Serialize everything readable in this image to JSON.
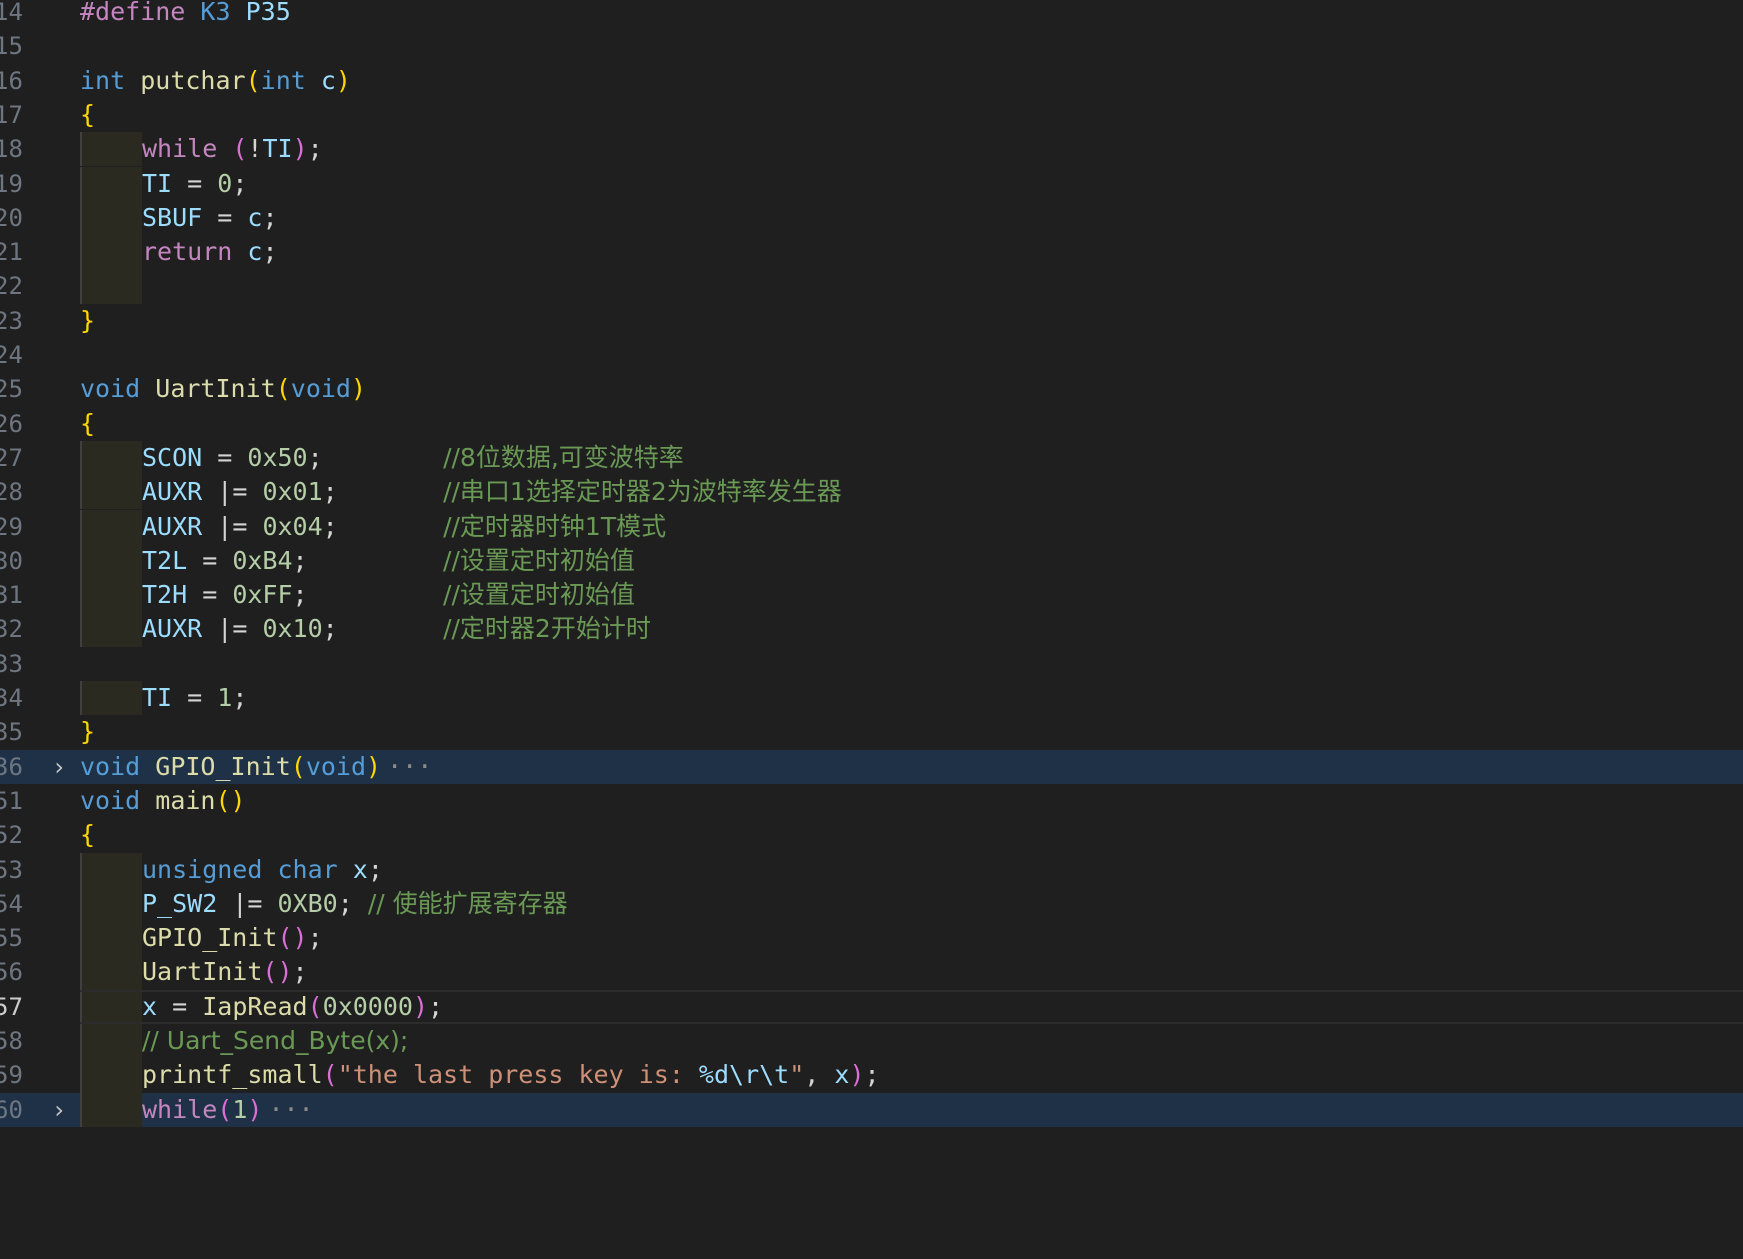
{
  "editor": {
    "lines": [
      {
        "n": "14",
        "tokens": [
          [
            "t-def",
            "#define"
          ],
          [
            "t-pun",
            " "
          ],
          [
            "t-mac",
            "K3"
          ],
          [
            "t-pun",
            " "
          ],
          [
            "t-var",
            "P35"
          ]
        ]
      },
      {
        "n": "15",
        "tokens": []
      },
      {
        "n": "16",
        "tokens": [
          [
            "t-kw",
            "int"
          ],
          [
            "t-pun",
            " "
          ],
          [
            "t-fn",
            "putchar"
          ],
          [
            "t-br1",
            "("
          ],
          [
            "t-kw",
            "int"
          ],
          [
            "t-pun",
            " "
          ],
          [
            "t-var",
            "c"
          ],
          [
            "t-br1",
            ")"
          ]
        ]
      },
      {
        "n": "17",
        "tokens": [
          [
            "t-br1",
            "{"
          ]
        ]
      },
      {
        "n": "18",
        "guide": true,
        "tokens": [
          [
            "t-ctl",
            "while"
          ],
          [
            "t-pun",
            " "
          ],
          [
            "t-br2",
            "("
          ],
          [
            "t-pun",
            "!"
          ],
          [
            "t-var",
            "TI"
          ],
          [
            "t-br2",
            ")"
          ],
          [
            "t-pun",
            ";"
          ]
        ]
      },
      {
        "n": "19",
        "guide": true,
        "tokens": [
          [
            "t-var",
            "TI"
          ],
          [
            "t-pun",
            " = "
          ],
          [
            "t-num",
            "0"
          ],
          [
            "t-pun",
            ";"
          ]
        ]
      },
      {
        "n": "20",
        "guide": true,
        "tokens": [
          [
            "t-var",
            "SBUF"
          ],
          [
            "t-pun",
            " = "
          ],
          [
            "t-var",
            "c"
          ],
          [
            "t-pun",
            ";"
          ]
        ]
      },
      {
        "n": "21",
        "guide": true,
        "tokens": [
          [
            "t-ctl",
            "return"
          ],
          [
            "t-pun",
            " "
          ],
          [
            "t-var",
            "c"
          ],
          [
            "t-pun",
            ";"
          ]
        ]
      },
      {
        "n": "22",
        "guide": true,
        "tokens": []
      },
      {
        "n": "23",
        "tokens": [
          [
            "t-br1",
            "}"
          ]
        ]
      },
      {
        "n": "24",
        "tokens": []
      },
      {
        "n": "25",
        "tokens": [
          [
            "t-kw",
            "void"
          ],
          [
            "t-pun",
            " "
          ],
          [
            "t-fn",
            "UartInit"
          ],
          [
            "t-br1",
            "("
          ],
          [
            "t-kw",
            "void"
          ],
          [
            "t-br1",
            ")"
          ]
        ]
      },
      {
        "n": "26",
        "tokens": [
          [
            "t-br1",
            "{"
          ]
        ]
      },
      {
        "n": "27",
        "guide": true,
        "tokens": [
          [
            "t-var",
            "SCON"
          ],
          [
            "t-pun",
            " = "
          ],
          [
            "t-num",
            "0x50"
          ],
          [
            "t-pun",
            ";        "
          ],
          [
            "t-com",
            "//8位数据,可变波特率"
          ]
        ]
      },
      {
        "n": "28",
        "guide": true,
        "tokens": [
          [
            "t-var",
            "AUXR"
          ],
          [
            "t-pun",
            " |= "
          ],
          [
            "t-num",
            "0x01"
          ],
          [
            "t-pun",
            ";       "
          ],
          [
            "t-com",
            "//串口1选择定时器2为波特率发生器"
          ]
        ]
      },
      {
        "n": "29",
        "guide": true,
        "tokens": [
          [
            "t-var",
            "AUXR"
          ],
          [
            "t-pun",
            " |= "
          ],
          [
            "t-num",
            "0x04"
          ],
          [
            "t-pun",
            ";       "
          ],
          [
            "t-com",
            "//定时器时钟1T模式"
          ]
        ]
      },
      {
        "n": "30",
        "guide": true,
        "tokens": [
          [
            "t-var",
            "T2L"
          ],
          [
            "t-pun",
            " = "
          ],
          [
            "t-num",
            "0xB4"
          ],
          [
            "t-pun",
            ";         "
          ],
          [
            "t-com",
            "//设置定时初始值"
          ]
        ]
      },
      {
        "n": "31",
        "guide": true,
        "tokens": [
          [
            "t-var",
            "T2H"
          ],
          [
            "t-pun",
            " = "
          ],
          [
            "t-num",
            "0xFF"
          ],
          [
            "t-pun",
            ";         "
          ],
          [
            "t-com",
            "//设置定时初始值"
          ]
        ]
      },
      {
        "n": "32",
        "guide": true,
        "tokens": [
          [
            "t-var",
            "AUXR"
          ],
          [
            "t-pun",
            " |= "
          ],
          [
            "t-num",
            "0x10"
          ],
          [
            "t-pun",
            ";       "
          ],
          [
            "t-com",
            "//定时器2开始计时"
          ]
        ]
      },
      {
        "n": "33",
        "tokens": []
      },
      {
        "n": "34",
        "guide": true,
        "tokens": [
          [
            "t-var",
            "TI"
          ],
          [
            "t-pun",
            " = "
          ],
          [
            "t-num",
            "1"
          ],
          [
            "t-pun",
            ";"
          ]
        ]
      },
      {
        "n": "35",
        "tokens": [
          [
            "t-br1",
            "}"
          ]
        ]
      },
      {
        "n": "36",
        "folded": true,
        "tokens": [
          [
            "t-kw",
            "void"
          ],
          [
            "t-pun",
            " "
          ],
          [
            "t-fn",
            "GPIO_Init"
          ],
          [
            "t-br1",
            "("
          ],
          [
            "t-kw",
            "void"
          ],
          [
            "t-br1",
            ")"
          ]
        ]
      },
      {
        "n": "51",
        "tokens": [
          [
            "t-kw",
            "void"
          ],
          [
            "t-pun",
            " "
          ],
          [
            "t-fn",
            "main"
          ],
          [
            "t-br1",
            "()"
          ]
        ]
      },
      {
        "n": "52",
        "tokens": [
          [
            "t-br1",
            "{"
          ]
        ]
      },
      {
        "n": "53",
        "guide": true,
        "tokens": [
          [
            "t-kw",
            "unsigned"
          ],
          [
            "t-pun",
            " "
          ],
          [
            "t-kw",
            "char"
          ],
          [
            "t-pun",
            " "
          ],
          [
            "t-var",
            "x"
          ],
          [
            "t-pun",
            ";"
          ]
        ]
      },
      {
        "n": "54",
        "guide": true,
        "tokens": [
          [
            "t-var",
            "P_SW2"
          ],
          [
            "t-pun",
            " |= "
          ],
          [
            "t-num",
            "0XB0"
          ],
          [
            "t-pun",
            "; "
          ],
          [
            "t-com",
            "// 使能扩展寄存器"
          ]
        ]
      },
      {
        "n": "55",
        "guide": true,
        "tokens": [
          [
            "t-fn",
            "GPIO_Init"
          ],
          [
            "t-br2",
            "()"
          ],
          [
            "t-pun",
            ";"
          ]
        ]
      },
      {
        "n": "56",
        "guide": true,
        "tokens": [
          [
            "t-fn",
            "UartInit"
          ],
          [
            "t-br2",
            "()"
          ],
          [
            "t-pun",
            ";"
          ]
        ]
      },
      {
        "n": "57",
        "guide": true,
        "current": true,
        "tokens": [
          [
            "t-var",
            "x"
          ],
          [
            "t-pun",
            " = "
          ],
          [
            "t-fn",
            "IapRead"
          ],
          [
            "t-br2",
            "("
          ],
          [
            "t-num",
            "0x0000"
          ],
          [
            "t-br2",
            ")"
          ],
          [
            "t-pun",
            ";"
          ]
        ]
      },
      {
        "n": "58",
        "guide": true,
        "tokens": [
          [
            "t-com",
            "// Uart_Send_Byte(x);"
          ]
        ]
      },
      {
        "n": "59",
        "guide": true,
        "tokens": [
          [
            "t-fn",
            "printf_small"
          ],
          [
            "t-br2",
            "("
          ],
          [
            "t-str",
            "\"the last press key is: "
          ],
          [
            "t-fmt",
            "%d\\r\\t"
          ],
          [
            "t-str",
            "\""
          ],
          [
            "t-pun",
            ", "
          ],
          [
            "t-var",
            "x"
          ],
          [
            "t-br2",
            ")"
          ],
          [
            "t-pun",
            ";"
          ]
        ]
      },
      {
        "n": "60",
        "guide": true,
        "folded": true,
        "tokens": [
          [
            "t-ctl",
            "while"
          ],
          [
            "t-br2",
            "("
          ],
          [
            "t-num",
            "1"
          ],
          [
            "t-br2",
            ")"
          ]
        ]
      }
    ],
    "fold_icon": "chevron-right-icon",
    "fold_glyph": "›",
    "ellipsis_glyph": "···"
  }
}
